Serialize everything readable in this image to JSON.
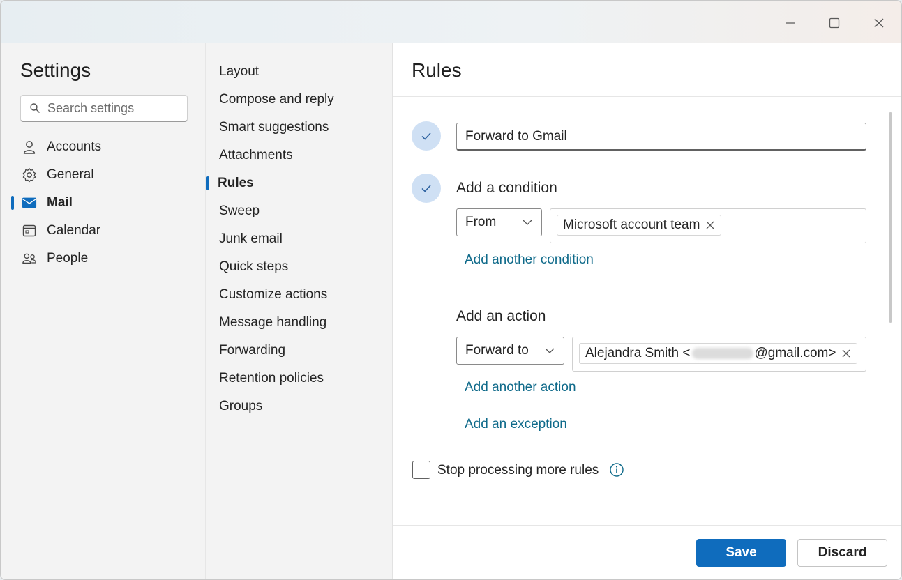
{
  "window": {
    "controls": [
      "minimize-icon",
      "maximize-icon",
      "close-icon"
    ]
  },
  "settings": {
    "title": "Settings",
    "search_placeholder": "Search settings",
    "nav": [
      {
        "label": "Accounts",
        "icon": "person-icon"
      },
      {
        "label": "General",
        "icon": "gear-icon"
      },
      {
        "label": "Mail",
        "icon": "mail-icon",
        "active": true
      },
      {
        "label": "Calendar",
        "icon": "calendar-icon"
      },
      {
        "label": "People",
        "icon": "people-icon"
      }
    ]
  },
  "mail_menu": {
    "items": [
      "Layout",
      "Compose and reply",
      "Smart suggestions",
      "Attachments",
      "Rules",
      "Sweep",
      "Junk email",
      "Quick steps",
      "Customize actions",
      "Message handling",
      "Forwarding",
      "Retention policies",
      "Groups"
    ],
    "active": "Rules"
  },
  "rules": {
    "title": "Rules",
    "rule_name": "Forward to Gmail",
    "condition_label": "Add a condition",
    "condition_field": "From",
    "condition_value": "Microsoft account team",
    "add_condition_link": "Add another condition",
    "action_label": "Add an action",
    "action_field": "Forward to",
    "action_value_prefix": "Alejandra Smith <",
    "action_value_suffix": "@gmail.com>",
    "add_action_link": "Add another action",
    "add_exception_link": "Add an exception",
    "stop_processing_label": "Stop processing more rules",
    "stop_processing_checked": false,
    "save_label": "Save",
    "discard_label": "Discard"
  },
  "colors": {
    "accent": "#0f6cbd",
    "link": "#0f6a8a",
    "check_bg": "#cfe0f4"
  }
}
